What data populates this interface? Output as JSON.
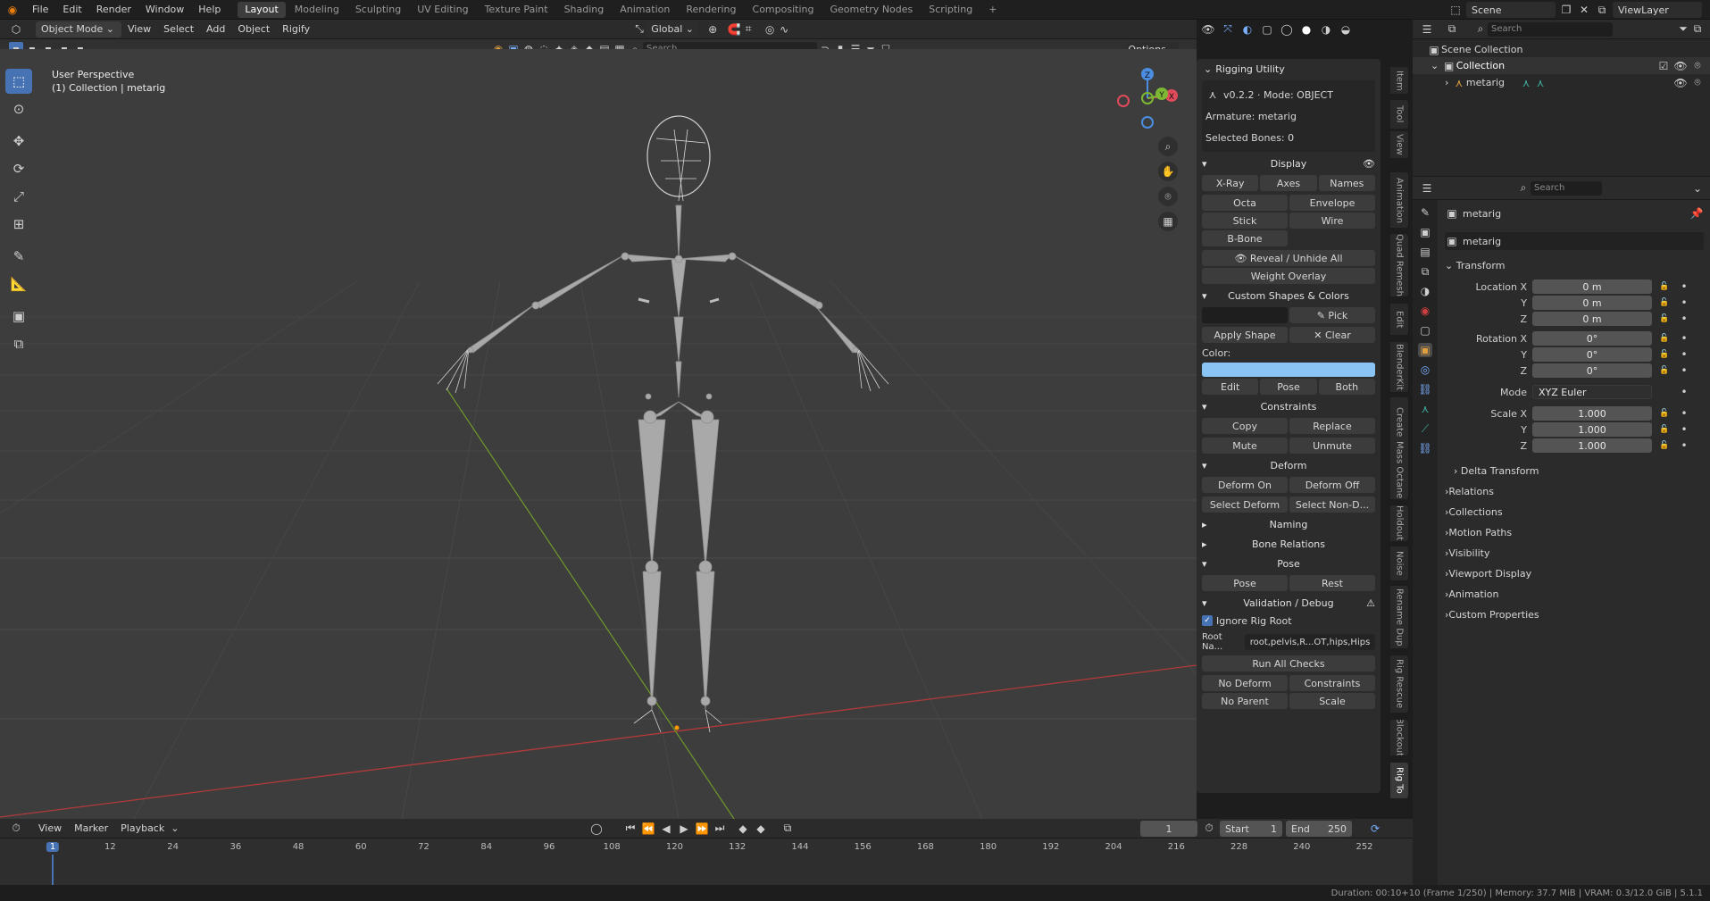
{
  "topbar": {
    "menus": [
      "File",
      "Edit",
      "Render",
      "Window",
      "Help"
    ],
    "workspaces": [
      "Layout",
      "Modeling",
      "Sculpting",
      "UV Editing",
      "Texture Paint",
      "Shading",
      "Animation",
      "Rendering",
      "Compositing",
      "Geometry Nodes",
      "Scripting"
    ],
    "add_tab": "+",
    "scene": "Scene",
    "view_layer": "ViewLayer"
  },
  "viewport_header": {
    "mode": "Object Mode",
    "menus": [
      "View",
      "Select",
      "Add",
      "Object",
      "Rigify"
    ],
    "orientation": "Global",
    "search_placeholder": "Search",
    "options": "Options"
  },
  "viewport": {
    "perspective": "User Perspective",
    "collection": "(1) Collection | metarig",
    "gizmo": {
      "z": "Z",
      "y": "Y",
      "x": "X"
    }
  },
  "rig_panel": {
    "title": "Rigging Utility",
    "version": "v0.2.2 · Mode: OBJECT",
    "armature": "Armature: metarig",
    "selected": "Selected Bones: 0",
    "display": {
      "title": "Display",
      "xray": "X-Ray",
      "axes": "Axes",
      "names": "Names",
      "octa": "Octa",
      "envelope": "Envelope",
      "stick": "Stick",
      "wire": "Wire",
      "bbone": "B-Bone",
      "reveal": "Reveal / Unhide All",
      "weight": "Weight Overlay"
    },
    "custom_shapes": {
      "title": "Custom Shapes & Colors",
      "pick": "Pick",
      "apply": "Apply Shape",
      "clear": "Clear",
      "color_label": "Color:",
      "color_value": "#89c4f4",
      "edit": "Edit",
      "pose": "Pose",
      "both": "Both"
    },
    "constraints": {
      "title": "Constraints",
      "copy": "Copy",
      "replace": "Replace",
      "mute": "Mute",
      "unmute": "Unmute"
    },
    "deform": {
      "title": "Deform",
      "on": "Deform On",
      "off": "Deform Off",
      "select": "Select Deform",
      "select_non": "Select Non-D..."
    },
    "naming": "Naming",
    "bone_relations": "Bone Relations",
    "pose": {
      "title": "Pose",
      "pose": "Pose",
      "rest": "Rest"
    },
    "validation": {
      "title": "Validation / Debug",
      "ignore_root": "Ignore Rig Root",
      "root_label": "Root Na...",
      "root_value": "root,pelvis,R...OT,hips,Hips",
      "run_all": "Run All Checks",
      "no_deform": "No Deform",
      "constraints": "Constraints",
      "no_parent": "No Parent",
      "scale": "Scale"
    }
  },
  "side_tabs": [
    "Item",
    "Tool",
    "View",
    "Animation",
    "Quad Remesh",
    "Edit",
    "BlenderKit",
    "Create",
    "Mass Octane",
    "Holdout",
    "Noise",
    "Rename Dup",
    "Rig Rescue",
    "Blockout",
    "Rig To"
  ],
  "outliner": {
    "search_placeholder": "Search",
    "scene_collection": "Scene Collection",
    "collection": "Collection",
    "object": "metarig"
  },
  "properties": {
    "search_placeholder": "Search",
    "object_name": "metarig",
    "datablock": "metarig",
    "transform": {
      "title": "Transform",
      "location_label": "Location X",
      "location": [
        "0 m",
        "0 m",
        "0 m"
      ],
      "rotation_label": "Rotation X",
      "rotation": [
        "0°",
        "0°",
        "0°"
      ],
      "axis_y": "Y",
      "axis_z": "Z",
      "mode_label": "Mode",
      "mode_value": "XYZ Euler",
      "scale_label": "Scale X",
      "scale": [
        "1.000",
        "1.000",
        "1.000"
      ],
      "delta": "Delta Transform"
    },
    "sections": [
      "Relations",
      "Collections",
      "Motion Paths",
      "Visibility",
      "Viewport Display",
      "Animation",
      "Custom Properties"
    ]
  },
  "timeline": {
    "menus": [
      "View",
      "Marker",
      "Playback"
    ],
    "current_frame": "1",
    "start_label": "Start",
    "start": "1",
    "end_label": "End",
    "end": "250",
    "ticks": [
      "1",
      "12",
      "24",
      "36",
      "48",
      "60",
      "72",
      "84",
      "96",
      "108",
      "120",
      "132",
      "144",
      "156",
      "168",
      "180",
      "192",
      "204",
      "216",
      "228",
      "240",
      "252"
    ]
  },
  "statusbar": {
    "text": "Duration: 00:10+10 (Frame 1/250) | Memory: 37.7 MiB | VRAM: 0.3/12.0 GiB | 5.1.1"
  }
}
